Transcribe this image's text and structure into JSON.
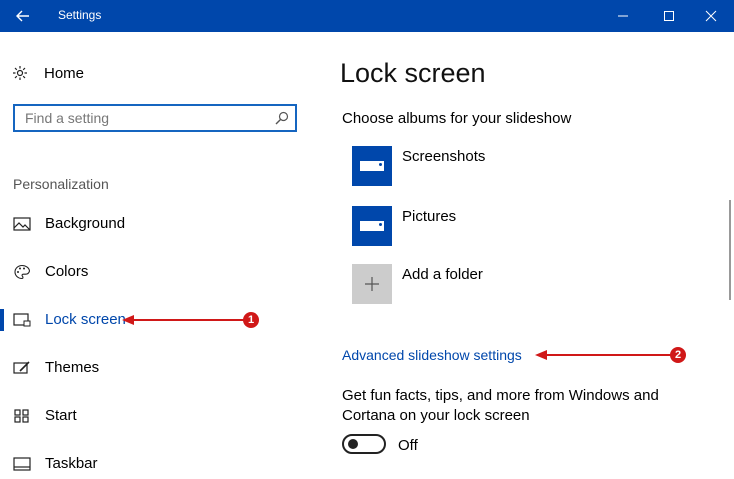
{
  "window": {
    "title": "Settings"
  },
  "sidebar": {
    "home_label": "Home",
    "search_placeholder": "Find a setting",
    "section_label": "Personalization",
    "items": [
      {
        "label": "Background",
        "icon": "picture-icon"
      },
      {
        "label": "Colors",
        "icon": "palette-icon"
      },
      {
        "label": "Lock screen",
        "icon": "lock-screen-icon",
        "active": true
      },
      {
        "label": "Themes",
        "icon": "brush-icon"
      },
      {
        "label": "Start",
        "icon": "start-grid-icon"
      },
      {
        "label": "Taskbar",
        "icon": "taskbar-icon"
      }
    ]
  },
  "main": {
    "title": "Lock screen",
    "albums_heading": "Choose albums for your slideshow",
    "albums": [
      {
        "name": "Screenshots"
      },
      {
        "name": "Pictures"
      }
    ],
    "add_folder_label": "Add a folder",
    "advanced_link": "Advanced slideshow settings",
    "fun_facts_text": "Get fun facts, tips, and more from Windows and Cortana on your lock screen",
    "toggle_state_label": "Off"
  },
  "annotations": [
    {
      "number": "1"
    },
    {
      "number": "2"
    }
  ],
  "colors": {
    "accent": "#0047ab",
    "annotation": "#d01818"
  }
}
